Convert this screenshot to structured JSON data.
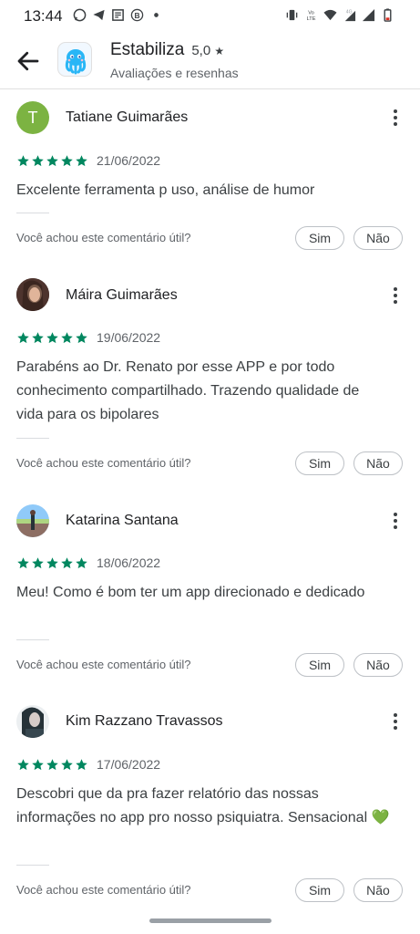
{
  "status_bar": {
    "time": "13:44",
    "left_icons": [
      "whatsapp-icon",
      "telegram-icon",
      "news-icon",
      "b-icon",
      "dot-icon"
    ],
    "right_icons": [
      "vibrate-icon",
      "volte-icon",
      "wifi-icon",
      "4g-signal-icon",
      "signal-icon",
      "battery-icon"
    ]
  },
  "header": {
    "title": "Estabiliza",
    "rating": "5,0",
    "rating_star": "★",
    "subtitle": "Avaliações e resenhas"
  },
  "reviews": [
    {
      "name": "Tatiane Guimarães",
      "avatar_letter": "T",
      "stars": 5,
      "date": "21/06/2022",
      "text": "Excelente ferramenta p uso, análise de humor",
      "helpful_question": "Você achou este comentário útil?",
      "yes_label": "Sim",
      "no_label": "Não"
    },
    {
      "name": "Máira Guimarães",
      "stars": 5,
      "date": "19/06/2022",
      "text": "Parabéns ao Dr. Renato por esse APP e por todo conhecimento compartilhado. Trazendo qualidade de vida para os bipolares",
      "helpful_question": "Você achou este comentário útil?",
      "yes_label": "Sim",
      "no_label": "Não"
    },
    {
      "name": "Katarina Santana",
      "stars": 5,
      "date": "18/06/2022",
      "text": "Meu! Como é bom ter um app direcionado e dedicado",
      "helpful_question": "Você achou este comentário útil?",
      "yes_label": "Sim",
      "no_label": "Não"
    },
    {
      "name": "Kim Razzano Travassos",
      "stars": 5,
      "date": "17/06/2022",
      "text": "Descobri que da pra fazer relatório das nossas informações no app pro nosso psiquiatra. Sensacional 💚",
      "helpful_question": "Você achou este comentário útil?",
      "yes_label": "Sim",
      "no_label": "Não"
    }
  ],
  "colors": {
    "star_green": "#01875f",
    "avatar_green": "#7cb342"
  }
}
